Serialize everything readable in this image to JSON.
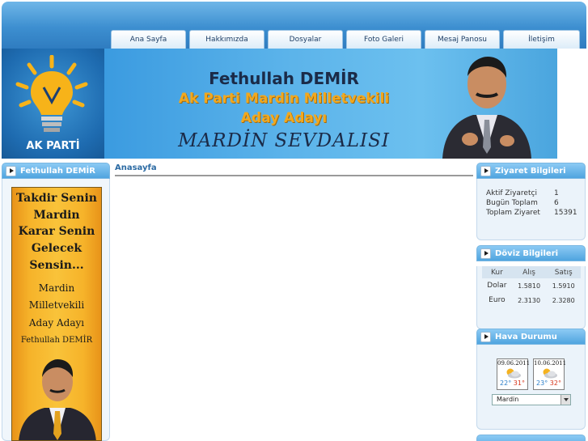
{
  "nav": {
    "items": [
      "Ana Sayfa",
      "Hakkımızda",
      "Dosyalar",
      "Foto Galeri",
      "Mesaj Panosu",
      "İletişim"
    ]
  },
  "banner": {
    "logo_text": "AK PARTİ",
    "name": "Fethullah DEMİR",
    "line1": "Ak Parti Mardin Milletvekili",
    "line2": "Aday Adayı",
    "slogan": "MARDİN SEVDALISI"
  },
  "left_panel": {
    "title": "Fethullah DEMİR",
    "poster_lines": [
      "Takdir Senin",
      "Mardin",
      "Karar Senin",
      "Gelecek",
      "Sensin...",
      "Mardin",
      "Milletvekili",
      "Aday Adayı",
      "Fethullah DEMİR"
    ]
  },
  "center": {
    "title": "Anasayfa"
  },
  "visitors": {
    "title": "Ziyaret Bilgileri",
    "rows": [
      {
        "label": "Aktif Ziyaretçi",
        "value": "1"
      },
      {
        "label": "Bugün Toplam",
        "value": "6"
      },
      {
        "label": "Toplam Ziyaret",
        "value": "15391"
      }
    ]
  },
  "currency": {
    "title": "Döviz Bilgileri",
    "headers": [
      "Kur",
      "Alış",
      "Satış"
    ],
    "rows": [
      {
        "name": "Dolar",
        "buy": "1.5810",
        "sell": "1.5910"
      },
      {
        "name": "Euro",
        "buy": "2.3130",
        "sell": "2.3280"
      }
    ]
  },
  "weather": {
    "title": "Hava Durumu",
    "days": [
      {
        "date": "09.06.2011",
        "low": "22°",
        "high": "31°",
        "icon": "partly-cloudy-icon"
      },
      {
        "date": "10.06.2011",
        "low": "23°",
        "high": "32°",
        "icon": "partly-cloudy-icon"
      }
    ],
    "city": "Mardin"
  },
  "colors": {
    "header_blue": "#3d8fd0",
    "panel_head": "#4fa4df",
    "accent_orange": "#f2a81e"
  }
}
